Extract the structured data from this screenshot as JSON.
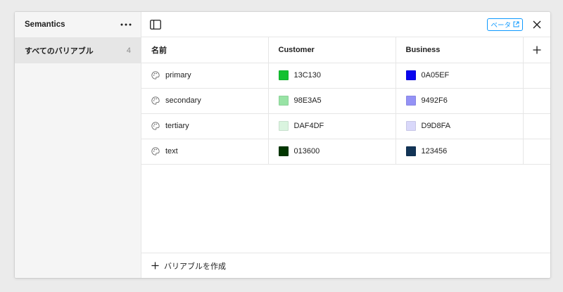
{
  "sidebar": {
    "title": "Semantics",
    "more_icon": "more-horizontal-icon",
    "items": [
      {
        "label": "すべてのバリアブル",
        "count": "4"
      }
    ]
  },
  "toolbar": {
    "toggle_icon": "sidebar-toggle-icon",
    "beta_label": "ベータ",
    "beta_icon": "external-link-icon",
    "close_icon": "close-icon",
    "accent": "#0d99ff"
  },
  "table": {
    "columns": {
      "name": "名前",
      "mode1": "Customer",
      "mode2": "Business",
      "add_icon": "plus-icon"
    },
    "rows": [
      {
        "name": "primary",
        "icon": "palette-icon",
        "mode1": {
          "value": "13C130",
          "color": "#13C130"
        },
        "mode2": {
          "value": "0A05EF",
          "color": "#0A05EF"
        }
      },
      {
        "name": "secondary",
        "icon": "palette-icon",
        "mode1": {
          "value": "98E3A5",
          "color": "#98E3A5"
        },
        "mode2": {
          "value": "9492F6",
          "color": "#9492F6"
        }
      },
      {
        "name": "tertiary",
        "icon": "palette-icon",
        "mode1": {
          "value": "DAF4DF",
          "color": "#DAF4DF"
        },
        "mode2": {
          "value": "D9D8FA",
          "color": "#D9D8FA"
        }
      },
      {
        "name": "text",
        "icon": "palette-icon",
        "mode1": {
          "value": "013600",
          "color": "#013600"
        },
        "mode2": {
          "value": "123456",
          "color": "#123456"
        }
      }
    ]
  },
  "footer": {
    "create_label": "バリアブルを作成",
    "create_icon": "plus-icon"
  }
}
